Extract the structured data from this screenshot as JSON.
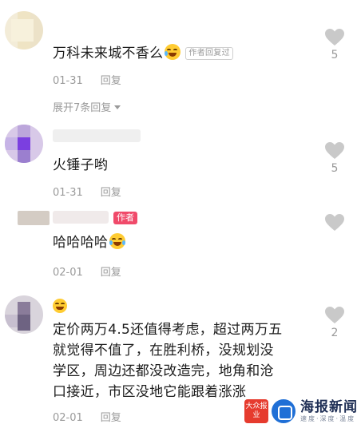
{
  "comments": [
    {
      "text": "万科未来城不香么",
      "author_tag": "作者回复过",
      "date": "01-31",
      "reply": "回复",
      "likes": "5",
      "expand": "展开7条回复"
    },
    {
      "text": "火锤子哟",
      "date": "01-31",
      "reply": "回复",
      "likes": "5"
    },
    {
      "author_badge": "作者",
      "text": "哈哈哈哈",
      "date": "02-01",
      "reply": "回复"
    },
    {
      "line1": "定价两万4.5还值得考虑，超过两万五",
      "line2": "就觉得不值了，在胜利桥，没规划没",
      "line3": "学区，周边还都没改造完，地角和沧",
      "line4": "口接近，市区没地它能跟着涨涨",
      "date": "02-01",
      "reply": "回复",
      "likes": "2"
    }
  ],
  "watermark": {
    "logo_text": "大众报业",
    "title": "海报新闻",
    "subtitle": "速度·深度·温度"
  },
  "colors": {
    "author_badge": "#f04a6a",
    "like_icon": "#c9c9c9",
    "meta_text": "#9a9a9a"
  }
}
